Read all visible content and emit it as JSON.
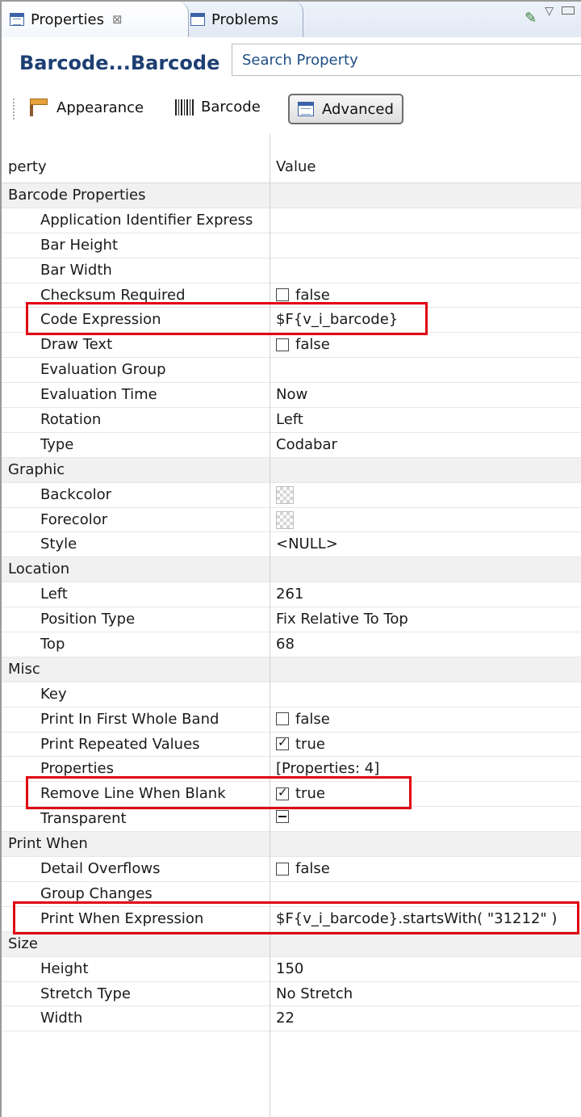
{
  "tabs": [
    {
      "label": "Properties",
      "close": "⊠"
    },
    {
      "label": "Problems"
    }
  ],
  "header": {
    "title": "Barcode...Barcode",
    "search_placeholder": "Search Property"
  },
  "toolbar": {
    "appearance": "Appearance",
    "barcode": "Barcode",
    "advanced": "Advanced"
  },
  "table": {
    "col_property": "perty",
    "col_value": "Value",
    "rows": [
      {
        "level": "cat",
        "name": "Barcode Properties",
        "value": ""
      },
      {
        "level": "child",
        "name": "Application Identifier Express",
        "value": ""
      },
      {
        "level": "child",
        "name": "Bar Height",
        "value": ""
      },
      {
        "level": "child",
        "name": "Bar Width",
        "value": ""
      },
      {
        "level": "child",
        "name": "Checksum Required",
        "value": "false",
        "checkbox": "unchecked"
      },
      {
        "level": "child",
        "name": "Code Expression",
        "value": "$F{v_i_barcode}",
        "highlight": true
      },
      {
        "level": "child",
        "name": "Draw Text",
        "value": "false",
        "checkbox": "unchecked"
      },
      {
        "level": "child",
        "name": "Evaluation Group",
        "value": ""
      },
      {
        "level": "child",
        "name": "Evaluation Time",
        "value": "Now"
      },
      {
        "level": "child",
        "name": "Rotation",
        "value": "Left"
      },
      {
        "level": "child",
        "name": "Type",
        "value": "Codabar"
      },
      {
        "level": "cat",
        "name": "Graphic",
        "value": ""
      },
      {
        "level": "child",
        "name": "Backcolor",
        "value": "",
        "swatch": true
      },
      {
        "level": "child",
        "name": "Forecolor",
        "value": "",
        "swatch": true
      },
      {
        "level": "child",
        "name": "Style",
        "value": "<NULL>"
      },
      {
        "level": "cat",
        "name": "Location",
        "value": ""
      },
      {
        "level": "child",
        "name": "Left",
        "value": "261"
      },
      {
        "level": "child",
        "name": "Position Type",
        "value": "Fix Relative To Top"
      },
      {
        "level": "child",
        "name": "Top",
        "value": "68"
      },
      {
        "level": "cat",
        "name": "Misc",
        "value": ""
      },
      {
        "level": "child",
        "name": "Key",
        "value": ""
      },
      {
        "level": "child",
        "name": "Print In First Whole Band",
        "value": "false",
        "checkbox": "unchecked"
      },
      {
        "level": "child",
        "name": "Print Repeated Values",
        "value": "true",
        "checkbox": "checked"
      },
      {
        "level": "child",
        "name": "Properties",
        "value": "[Properties: 4]"
      },
      {
        "level": "child",
        "name": "Remove Line When Blank",
        "value": "true",
        "checkbox": "checked",
        "highlight": true
      },
      {
        "level": "child",
        "name": "Transparent",
        "value": "",
        "checkbox": "mixed"
      },
      {
        "level": "cat",
        "name": "Print When",
        "value": ""
      },
      {
        "level": "child",
        "name": "Detail Overflows",
        "value": "false",
        "checkbox": "unchecked"
      },
      {
        "level": "child",
        "name": "Group Changes",
        "value": ""
      },
      {
        "level": "child",
        "name": "Print When Expression",
        "value": "$F{v_i_barcode}.startsWith( \"31212\" )",
        "highlight": true
      },
      {
        "level": "cat",
        "name": "Size",
        "value": ""
      },
      {
        "level": "child",
        "name": "Height",
        "value": "150"
      },
      {
        "level": "child",
        "name": "Stretch Type",
        "value": "No Stretch"
      },
      {
        "level": "child",
        "name": "Width",
        "value": "22"
      }
    ]
  },
  "colors": {
    "highlight": "#e00012",
    "title": "#1d3f73"
  }
}
